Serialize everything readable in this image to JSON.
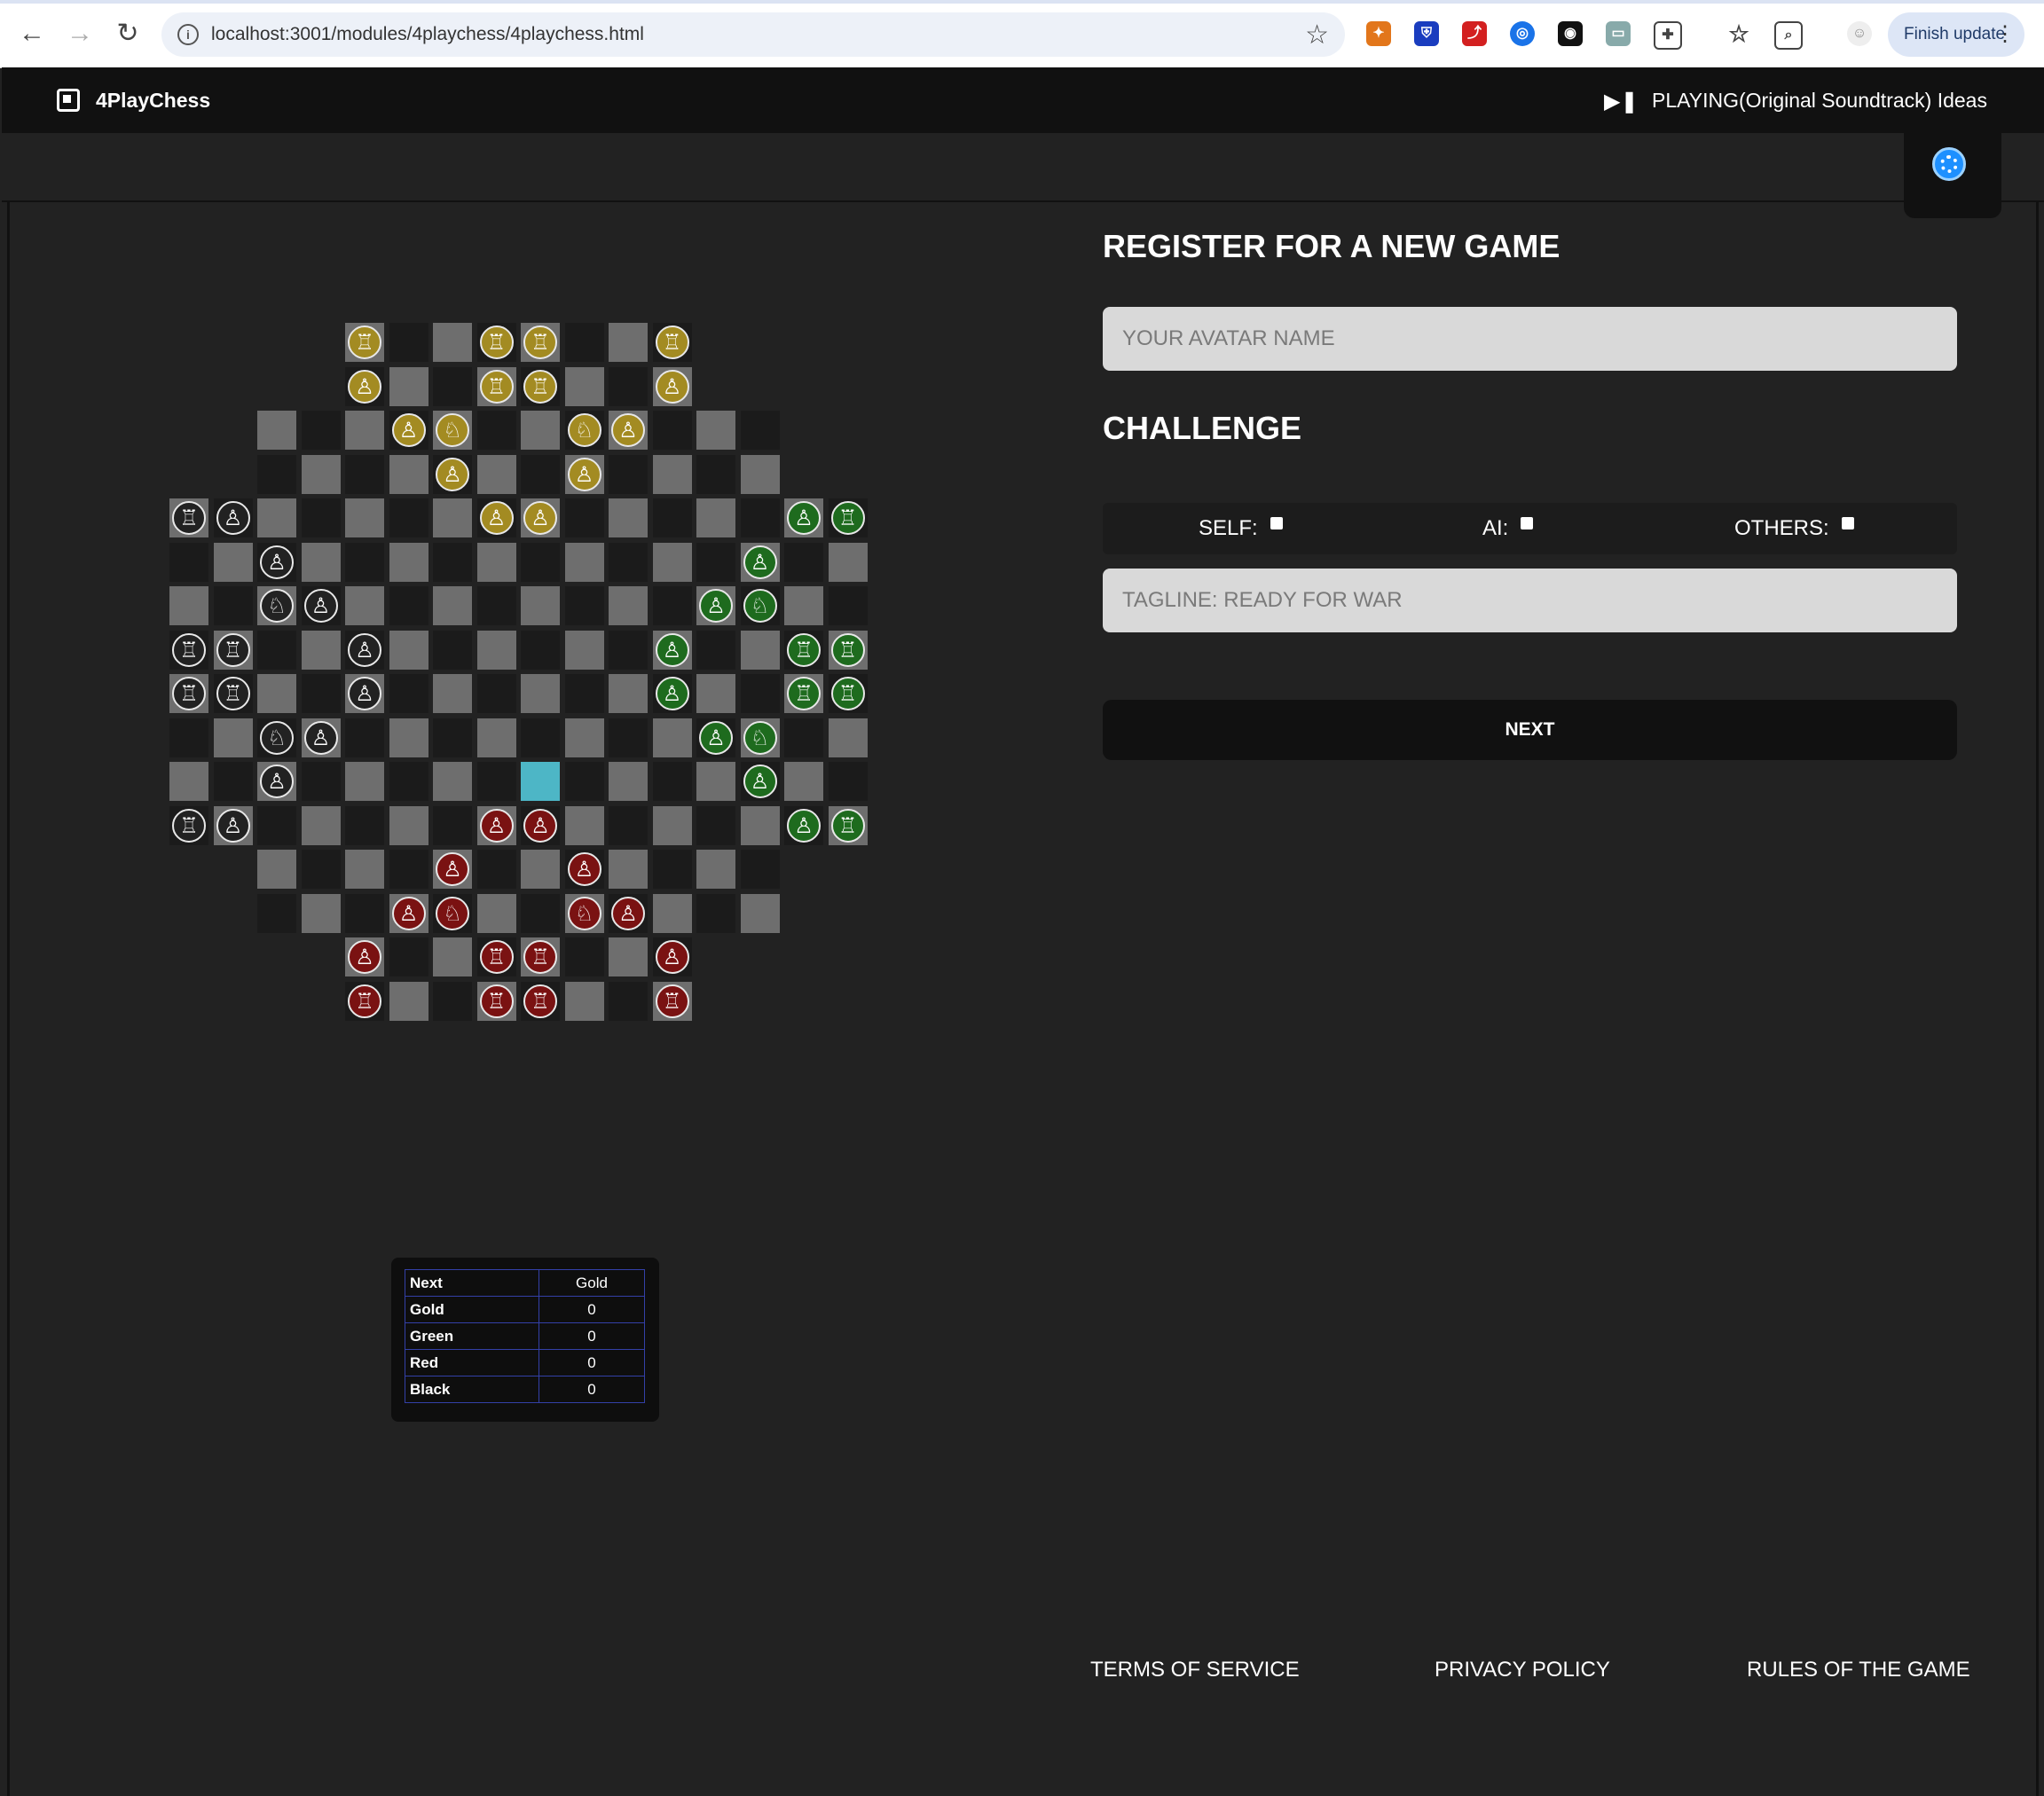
{
  "browser": {
    "url": "localhost:3001/modules/4playchess/4playchess.html",
    "finish_update": "Finish update"
  },
  "app": {
    "title": "4PlayChess",
    "now_playing": "PLAYING(Original Soundtrack) Ideas"
  },
  "colors": {
    "gold": "#a38b22",
    "green": "#1e6b1e",
    "red": "#7a1212",
    "black": "#222222",
    "highlight": "#4db6c6"
  },
  "board": {
    "highlighted": [
      11,
      9
    ],
    "pieces": [
      {
        "r": 1,
        "c": 5,
        "p": "gold",
        "t": "rook"
      },
      {
        "r": 1,
        "c": 8,
        "p": "gold",
        "t": "rook"
      },
      {
        "r": 1,
        "c": 9,
        "p": "gold",
        "t": "rook"
      },
      {
        "r": 1,
        "c": 12,
        "p": "gold",
        "t": "rook"
      },
      {
        "r": 2,
        "c": 5,
        "p": "gold",
        "t": "pawn"
      },
      {
        "r": 2,
        "c": 8,
        "p": "gold",
        "t": "rook"
      },
      {
        "r": 2,
        "c": 9,
        "p": "gold",
        "t": "rook"
      },
      {
        "r": 2,
        "c": 12,
        "p": "gold",
        "t": "pawn"
      },
      {
        "r": 3,
        "c": 6,
        "p": "gold",
        "t": "pawn"
      },
      {
        "r": 3,
        "c": 7,
        "p": "gold",
        "t": "knight"
      },
      {
        "r": 3,
        "c": 10,
        "p": "gold",
        "t": "knight"
      },
      {
        "r": 3,
        "c": 11,
        "p": "gold",
        "t": "pawn"
      },
      {
        "r": 4,
        "c": 7,
        "p": "gold",
        "t": "pawn"
      },
      {
        "r": 4,
        "c": 10,
        "p": "gold",
        "t": "pawn"
      },
      {
        "r": 5,
        "c": 8,
        "p": "gold",
        "t": "pawn"
      },
      {
        "r": 5,
        "c": 9,
        "p": "gold",
        "t": "pawn"
      },
      {
        "r": 5,
        "c": 1,
        "p": "black",
        "t": "rook"
      },
      {
        "r": 5,
        "c": 2,
        "p": "black",
        "t": "pawn"
      },
      {
        "r": 5,
        "c": 15,
        "p": "green",
        "t": "pawn"
      },
      {
        "r": 5,
        "c": 16,
        "p": "green",
        "t": "rook"
      },
      {
        "r": 6,
        "c": 3,
        "p": "black",
        "t": "pawn"
      },
      {
        "r": 6,
        "c": 14,
        "p": "green",
        "t": "pawn"
      },
      {
        "r": 7,
        "c": 3,
        "p": "black",
        "t": "knight"
      },
      {
        "r": 7,
        "c": 4,
        "p": "black",
        "t": "pawn"
      },
      {
        "r": 7,
        "c": 13,
        "p": "green",
        "t": "pawn"
      },
      {
        "r": 7,
        "c": 14,
        "p": "green",
        "t": "knight"
      },
      {
        "r": 8,
        "c": 1,
        "p": "black",
        "t": "rook"
      },
      {
        "r": 8,
        "c": 2,
        "p": "black",
        "t": "rook"
      },
      {
        "r": 8,
        "c": 5,
        "p": "black",
        "t": "pawn"
      },
      {
        "r": 8,
        "c": 12,
        "p": "green",
        "t": "pawn"
      },
      {
        "r": 8,
        "c": 15,
        "p": "green",
        "t": "rook"
      },
      {
        "r": 8,
        "c": 16,
        "p": "green",
        "t": "rook"
      },
      {
        "r": 9,
        "c": 1,
        "p": "black",
        "t": "rook"
      },
      {
        "r": 9,
        "c": 2,
        "p": "black",
        "t": "rook"
      },
      {
        "r": 9,
        "c": 5,
        "p": "black",
        "t": "pawn"
      },
      {
        "r": 9,
        "c": 12,
        "p": "green",
        "t": "pawn"
      },
      {
        "r": 9,
        "c": 15,
        "p": "green",
        "t": "rook"
      },
      {
        "r": 9,
        "c": 16,
        "p": "green",
        "t": "rook"
      },
      {
        "r": 10,
        "c": 3,
        "p": "black",
        "t": "knight"
      },
      {
        "r": 10,
        "c": 4,
        "p": "black",
        "t": "pawn"
      },
      {
        "r": 10,
        "c": 13,
        "p": "green",
        "t": "pawn"
      },
      {
        "r": 10,
        "c": 14,
        "p": "green",
        "t": "knight"
      },
      {
        "r": 11,
        "c": 3,
        "p": "black",
        "t": "pawn"
      },
      {
        "r": 11,
        "c": 14,
        "p": "green",
        "t": "pawn"
      },
      {
        "r": 12,
        "c": 1,
        "p": "black",
        "t": "rook"
      },
      {
        "r": 12,
        "c": 2,
        "p": "black",
        "t": "pawn"
      },
      {
        "r": 12,
        "c": 8,
        "p": "red",
        "t": "pawn"
      },
      {
        "r": 12,
        "c": 9,
        "p": "red",
        "t": "pawn"
      },
      {
        "r": 12,
        "c": 15,
        "p": "green",
        "t": "pawn"
      },
      {
        "r": 12,
        "c": 16,
        "p": "green",
        "t": "rook"
      },
      {
        "r": 13,
        "c": 7,
        "p": "red",
        "t": "pawn"
      },
      {
        "r": 13,
        "c": 10,
        "p": "red",
        "t": "pawn"
      },
      {
        "r": 14,
        "c": 6,
        "p": "red",
        "t": "pawn"
      },
      {
        "r": 14,
        "c": 7,
        "p": "red",
        "t": "knight"
      },
      {
        "r": 14,
        "c": 10,
        "p": "red",
        "t": "knight"
      },
      {
        "r": 14,
        "c": 11,
        "p": "red",
        "t": "pawn"
      },
      {
        "r": 15,
        "c": 5,
        "p": "red",
        "t": "pawn"
      },
      {
        "r": 15,
        "c": 8,
        "p": "red",
        "t": "rook"
      },
      {
        "r": 15,
        "c": 9,
        "p": "red",
        "t": "rook"
      },
      {
        "r": 15,
        "c": 12,
        "p": "red",
        "t": "pawn"
      },
      {
        "r": 16,
        "c": 5,
        "p": "red",
        "t": "rook"
      },
      {
        "r": 16,
        "c": 8,
        "p": "red",
        "t": "rook"
      },
      {
        "r": 16,
        "c": 9,
        "p": "red",
        "t": "rook"
      },
      {
        "r": 16,
        "c": 12,
        "p": "red",
        "t": "rook"
      }
    ]
  },
  "score": {
    "rows": [
      {
        "label": "Next",
        "value": "Gold"
      },
      {
        "label": "Gold",
        "value": "0"
      },
      {
        "label": "Green",
        "value": "0"
      },
      {
        "label": "Red",
        "value": "0"
      },
      {
        "label": "Black",
        "value": "0"
      }
    ]
  },
  "form": {
    "heading": "REGISTER FOR A NEW GAME",
    "avatar_placeholder": "YOUR AVATAR NAME",
    "challenge_heading": "CHALLENGE",
    "options": {
      "self": "SELF:",
      "ai": "AI:",
      "others": "OTHERS:"
    },
    "tagline_placeholder": "TAGLINE: READY FOR WAR",
    "next_label": "NEXT"
  },
  "footer": {
    "terms": "TERMS OF SERVICE",
    "privacy": "PRIVACY POLICY",
    "rules": "RULES OF THE GAME"
  }
}
